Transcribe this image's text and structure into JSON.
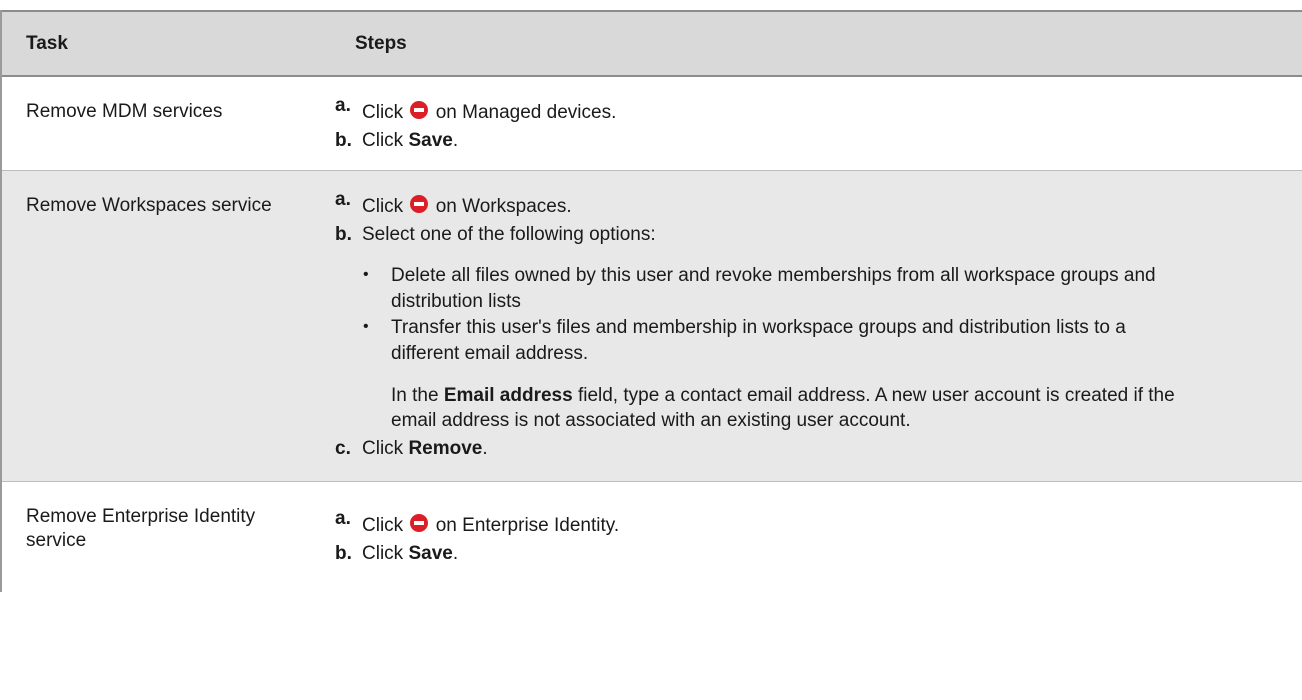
{
  "header": {
    "task": "Task",
    "steps": "Steps"
  },
  "rows": [
    {
      "task": "Remove MDM services",
      "steps": [
        {
          "label": "a.",
          "pre": "Click",
          "post": "on Managed devices."
        },
        {
          "label": "b.",
          "pre": "Click",
          "bold": "Save",
          "post": "."
        }
      ]
    },
    {
      "task": "Remove Workspaces service",
      "steps": [
        {
          "label": "a.",
          "pre": "Click",
          "post": "on Workspaces."
        },
        {
          "label": "b.",
          "text": "Select one of the following options:"
        },
        {
          "label": "c.",
          "pre": "Click",
          "bold": "Remove",
          "post": "."
        }
      ],
      "bullets": [
        "Delete all files owned by this user and revoke memberships from all workspace groups and distribution lists",
        "Transfer this user's files and membership in workspace groups and distribution lists to a different email address."
      ],
      "note": {
        "pre": "In the",
        "bold": "Email address",
        "post": "field, type a contact email address. A new user account is created if the email address is not associated with an existing user account."
      }
    },
    {
      "task": "Remove Enterprise Identity service",
      "steps": [
        {
          "label": "a.",
          "pre": "Click",
          "post": "on Enterprise Identity."
        },
        {
          "label": "b.",
          "pre": "Click",
          "bold": "Save",
          "post": "."
        }
      ]
    }
  ],
  "icons": {
    "remove": "remove-circle-icon"
  },
  "colors": {
    "remove_icon": "#dc1f26",
    "header_bg": "#d9d9d9",
    "alt_row_bg": "#e8e8e8"
  }
}
